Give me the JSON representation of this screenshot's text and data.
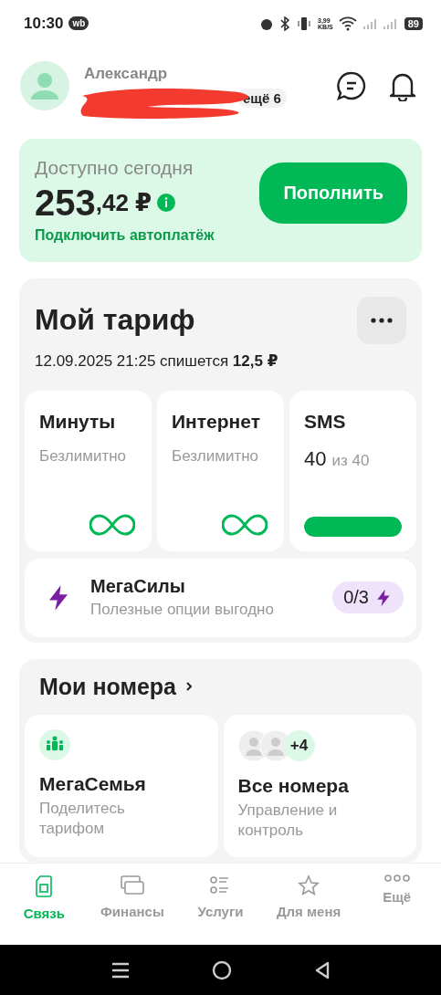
{
  "status_bar": {
    "time": "10:30",
    "app_badge": "wb",
    "speed": "3,99",
    "speed_unit": "KB/S",
    "battery": "89"
  },
  "profile": {
    "name": "Александр",
    "more_numbers": "ещё 6"
  },
  "balance": {
    "label": "Доступно сегодня",
    "amount": "253",
    "cents": ",42 ₽",
    "topup_button": "Пополнить",
    "autopay_link": "Подключить автоплатёж"
  },
  "tariff": {
    "title": "Мой тариф",
    "charge": "12.09.2025 21:25 спишется **12,5 ₽**",
    "packages": [
      {
        "kind": "unlimited",
        "title": "Минуты",
        "subtitle": "Безлимитно"
      },
      {
        "kind": "unlimited",
        "title": "Интернет",
        "subtitle": "Безлимитно"
      },
      {
        "kind": "counter",
        "title": "SMS",
        "remaining": "40",
        "total": "из 40",
        "level": 1
      }
    ],
    "megasily": {
      "title": "МегаСилы",
      "subtitle": "Полезные опции выгодно",
      "counter": "0/3"
    }
  },
  "numbers": {
    "title": "Мои номера",
    "cards": [
      {
        "kind": "family",
        "title": "МегаСемья",
        "subtitle": "Поделитесь тарифом"
      },
      {
        "kind": "all",
        "title": "Все номера",
        "subtitle": "Управление и контроль",
        "extra": "+4"
      }
    ]
  },
  "bottom_nav": [
    {
      "label": "Связь",
      "selected": true
    },
    {
      "label": "Финансы",
      "selected": false
    },
    {
      "label": "Услуги",
      "selected": false
    },
    {
      "label": "Для меня",
      "selected": false
    },
    {
      "label": "Ещё",
      "selected": false
    }
  ]
}
